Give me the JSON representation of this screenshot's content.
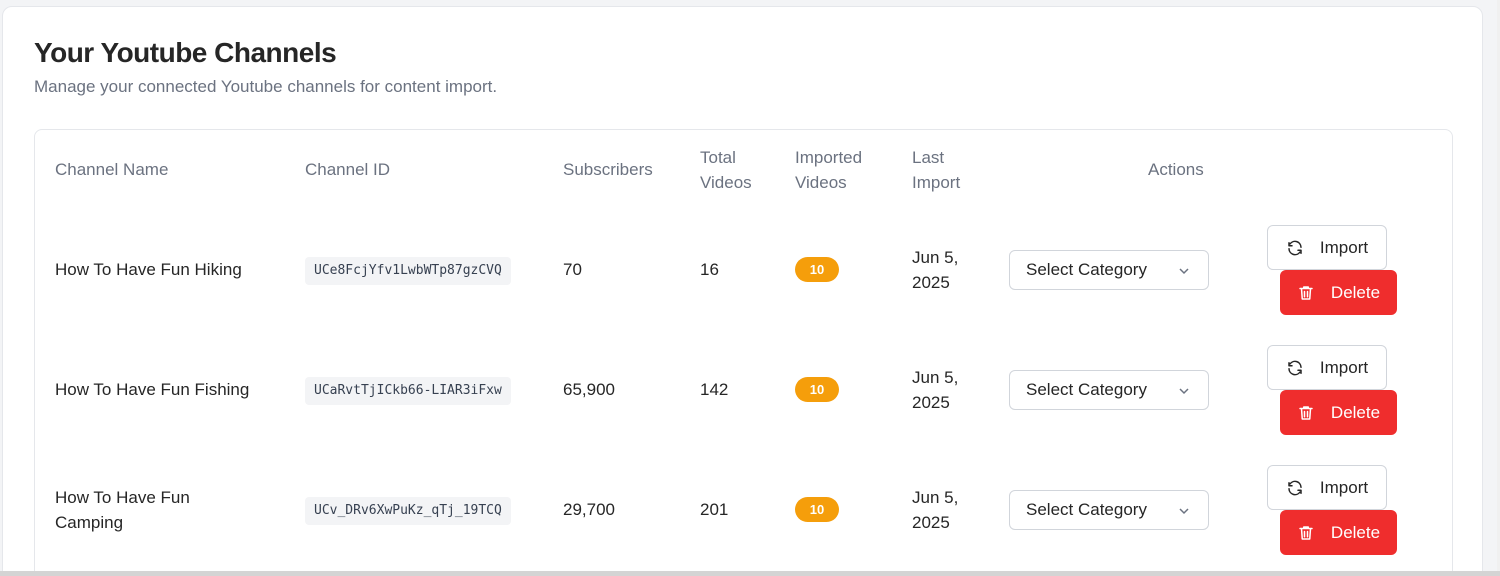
{
  "header": {
    "title": "Your Youtube Channels",
    "subtitle": "Manage your connected Youtube channels for content import."
  },
  "table": {
    "columns": {
      "channel_name": "Channel Name",
      "channel_id": "Channel ID",
      "subscribers": "Subscribers",
      "total_videos_1": "Total",
      "total_videos_2": "Videos",
      "imported_videos_1": "Imported",
      "imported_videos_2": "Videos",
      "last_import_1": "Last",
      "last_import_2": "Import",
      "actions": "Actions"
    },
    "rows": [
      {
        "name": "How To Have Fun Hiking",
        "name_line2": "",
        "channel_id": "UCe8FcjYfv1LwbWTp87gzCVQ",
        "subscribers": "70",
        "total_videos": "16",
        "imported_videos": "10",
        "last_import_1": "Jun 5,",
        "last_import_2": "2025",
        "category": "Select Category",
        "import_label": "Import",
        "delete_label": "Delete"
      },
      {
        "name": "How To Have Fun Fishing",
        "name_line2": "",
        "channel_id": "UCaRvtTjICkb66-LIAR3iFxw",
        "subscribers": "65,900",
        "total_videos": "142",
        "imported_videos": "10",
        "last_import_1": "Jun 5,",
        "last_import_2": "2025",
        "category": "Select Category",
        "import_label": "Import",
        "delete_label": "Delete"
      },
      {
        "name": "How To Have Fun",
        "name_line2": "Camping",
        "channel_id": "UCv_DRv6XwPuKz_qTj_19TCQ",
        "subscribers": "29,700",
        "total_videos": "201",
        "imported_videos": "10",
        "last_import_1": "Jun 5,",
        "last_import_2": "2025",
        "category": "Select Category",
        "import_label": "Import",
        "delete_label": "Delete"
      }
    ]
  },
  "colors": {
    "badge": "#f59e0b",
    "delete": "#ef2d2d",
    "text": "#262626",
    "muted": "#6b7280"
  },
  "icons": {
    "import": "refresh-icon",
    "delete": "trash-icon",
    "select": "chevron-down-icon"
  }
}
